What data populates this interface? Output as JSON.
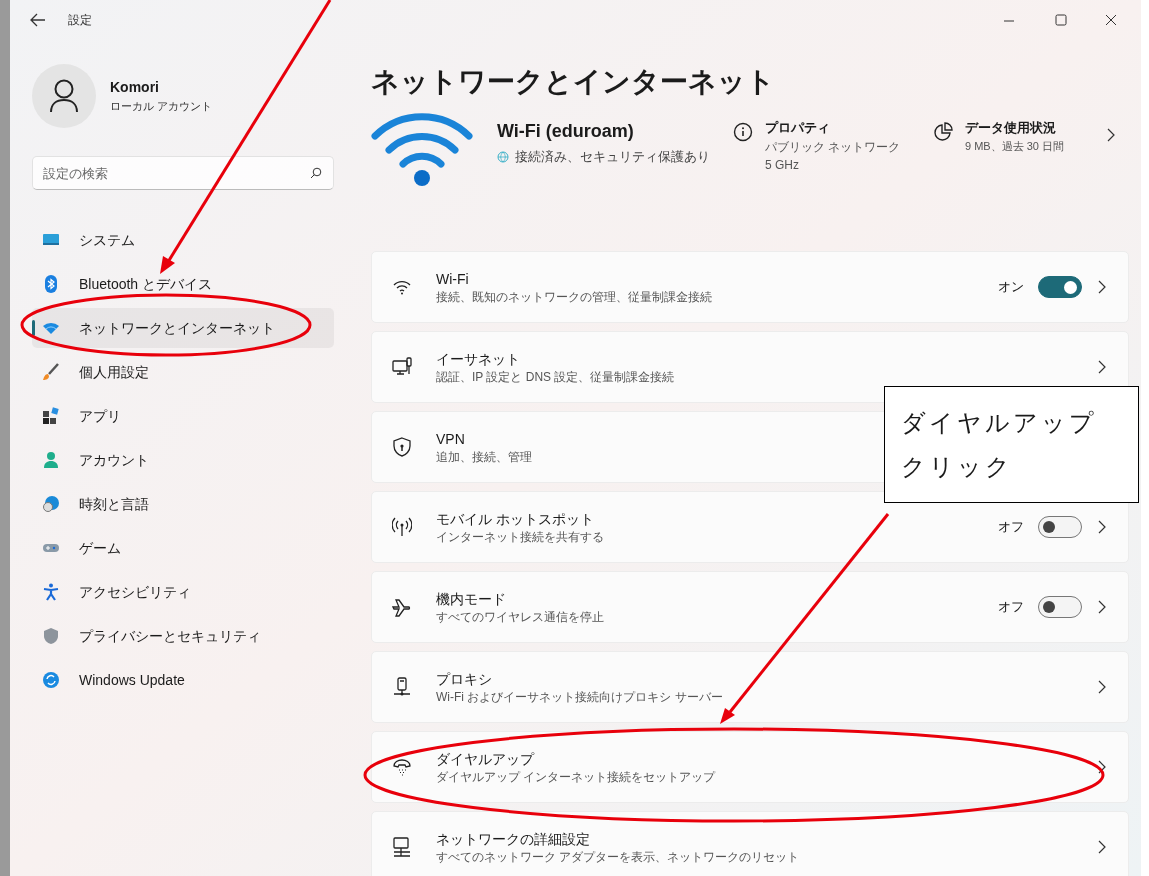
{
  "window": {
    "title": "設定"
  },
  "account": {
    "name": "Komori",
    "type": "ローカル アカウント"
  },
  "search": {
    "placeholder": "設定の検索"
  },
  "nav": [
    {
      "label": "システム",
      "selected": false
    },
    {
      "label": "Bluetooth とデバイス",
      "selected": false
    },
    {
      "label": "ネットワークとインターネット",
      "selected": true
    },
    {
      "label": "個人用設定",
      "selected": false
    },
    {
      "label": "アプリ",
      "selected": false
    },
    {
      "label": "アカウント",
      "selected": false
    },
    {
      "label": "時刻と言語",
      "selected": false
    },
    {
      "label": "ゲーム",
      "selected": false
    },
    {
      "label": "アクセシビリティ",
      "selected": false
    },
    {
      "label": "プライバシーとセキュリティ",
      "selected": false
    },
    {
      "label": "Windows Update",
      "selected": false
    }
  ],
  "page_title": "ネットワークとインターネット",
  "connection": {
    "name": "Wi-Fi (eduroam)",
    "status": "接続済み、セキュリティ保護あり",
    "properties": {
      "title": "プロパティ",
      "lines": [
        "パブリック ネットワーク",
        "5 GHz"
      ]
    },
    "data_usage": {
      "title": "データ使用状況",
      "detail": "9 MB、過去 30 日間"
    }
  },
  "settings": [
    {
      "title": "Wi-Fi",
      "subtitle": "接続、既知のネットワークの管理、従量制課金接続",
      "toggle": {
        "on": true,
        "label": "オン"
      }
    },
    {
      "title": "イーサネット",
      "subtitle": "認証、IP 設定と DNS 設定、従量制課金接続"
    },
    {
      "title": "VPN",
      "subtitle": "追加、接続、管理"
    },
    {
      "title": "モバイル ホットスポット",
      "subtitle": "インターネット接続を共有する",
      "toggle": {
        "on": false,
        "label": "オフ"
      }
    },
    {
      "title": "機内モード",
      "subtitle": "すべてのワイヤレス通信を停止",
      "toggle": {
        "on": false,
        "label": "オフ"
      }
    },
    {
      "title": "プロキシ",
      "subtitle": "Wi-Fi およびイーサネット接続向けプロキシ サーバー"
    },
    {
      "title": "ダイヤルアップ",
      "subtitle": "ダイヤルアップ インターネット接続をセットアップ"
    },
    {
      "title": "ネットワークの詳細設定",
      "subtitle": "すべてのネットワーク アダプターを表示、ネットワークのリセット"
    }
  ],
  "annotation": {
    "callout": "ダイヤルアップクリック"
  }
}
